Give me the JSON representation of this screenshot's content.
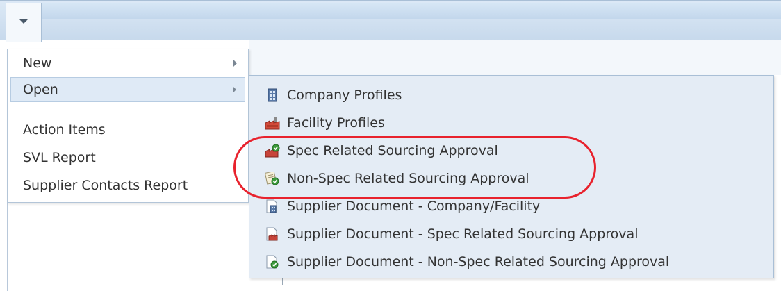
{
  "menu": {
    "trigger_icon": "chevron-down-icon",
    "items": [
      {
        "label": "New",
        "has_submenu": true
      },
      {
        "label": "Open",
        "has_submenu": true,
        "active": true
      },
      {
        "label": "Action Items"
      },
      {
        "label": "SVL Report"
      },
      {
        "label": "Supplier Contacts Report"
      }
    ]
  },
  "submenu": {
    "items": [
      {
        "label": "Company Profiles",
        "icon": "building-icon"
      },
      {
        "label": "Facility Profiles",
        "icon": "factory-icon"
      },
      {
        "label": "Spec Related Sourcing Approval",
        "icon": "approval-icon"
      },
      {
        "label": "Non-Spec Related Sourcing Approval",
        "icon": "approval-document-icon"
      },
      {
        "label": "Supplier Document - Company/Facility",
        "icon": "document-building-icon"
      },
      {
        "label": "Supplier Document - Spec Related Sourcing Approval",
        "icon": "document-factory-icon"
      },
      {
        "label": "Supplier Document - Non-Spec Related Sourcing Approval",
        "icon": "document-check-icon"
      }
    ]
  },
  "colors": {
    "highlight": "#e8222d",
    "menu_active_bg": "#dfeaf6",
    "submenu_bg": "#e4ecf5"
  }
}
